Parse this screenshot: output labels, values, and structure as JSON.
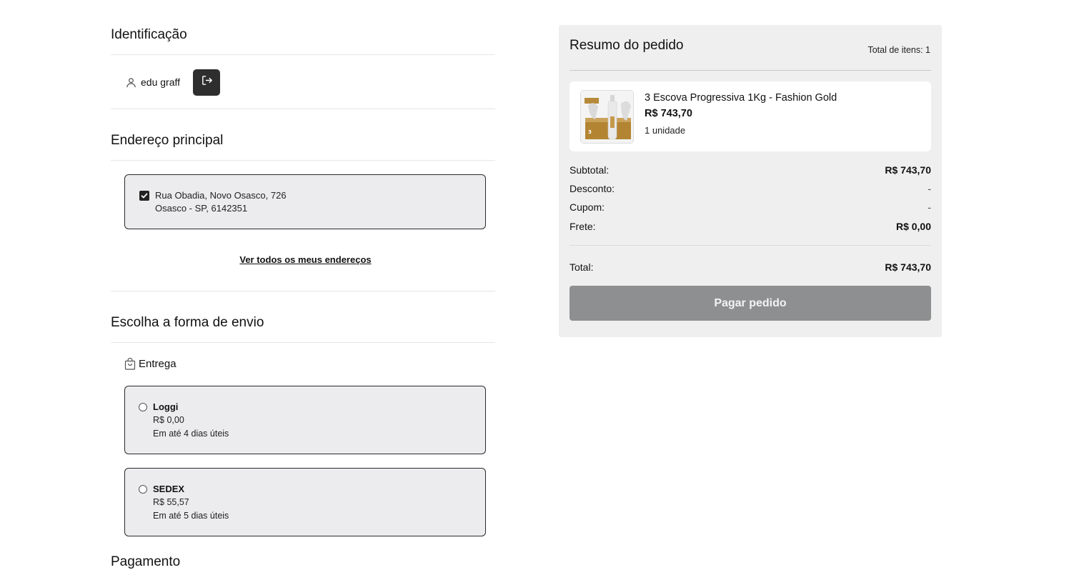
{
  "identification": {
    "title": "Identificação",
    "user_name": "edu graff"
  },
  "address": {
    "title": "Endereço principal",
    "line1": "Rua Obadia, Novo Osasco, 726",
    "line2": "Osasco - SP, 6142351",
    "checked": true,
    "view_all_label": "Ver todos os meus endereços"
  },
  "shipping": {
    "title": "Escolha a forma de envio",
    "delivery_label": "Entrega",
    "options": [
      {
        "name": "Loggi",
        "price": "R$ 0,00",
        "eta": "Em até 4 dias úteis"
      },
      {
        "name": "SEDEX",
        "price": "R$ 55,57",
        "eta": "Em até 5 dias úteis"
      }
    ]
  },
  "payment": {
    "title": "Pagamento"
  },
  "summary": {
    "title": "Resumo do pedido",
    "item_count": "Total de itens: 1",
    "product": {
      "name": "3 Escova Progressiva 1Kg - Fashion Gold",
      "price": "R$ 743,70",
      "quantity": "1 unidade"
    },
    "rows": [
      {
        "label": "Subtotal:",
        "value": "R$ 743,70"
      },
      {
        "label": "Desconto:",
        "value": "-"
      },
      {
        "label": "Cupom:",
        "value": "-"
      },
      {
        "label": "Frete:",
        "value": "R$ 0,00"
      }
    ],
    "total_label": "Total:",
    "total_value": "R$ 743,70",
    "pay_button": "Pagar pedido"
  },
  "colors": {
    "card_bg": "#ececef",
    "summary_bg": "#efefef",
    "button_disabled": "#8e8f90",
    "logout_bg": "#2e2e2e"
  }
}
